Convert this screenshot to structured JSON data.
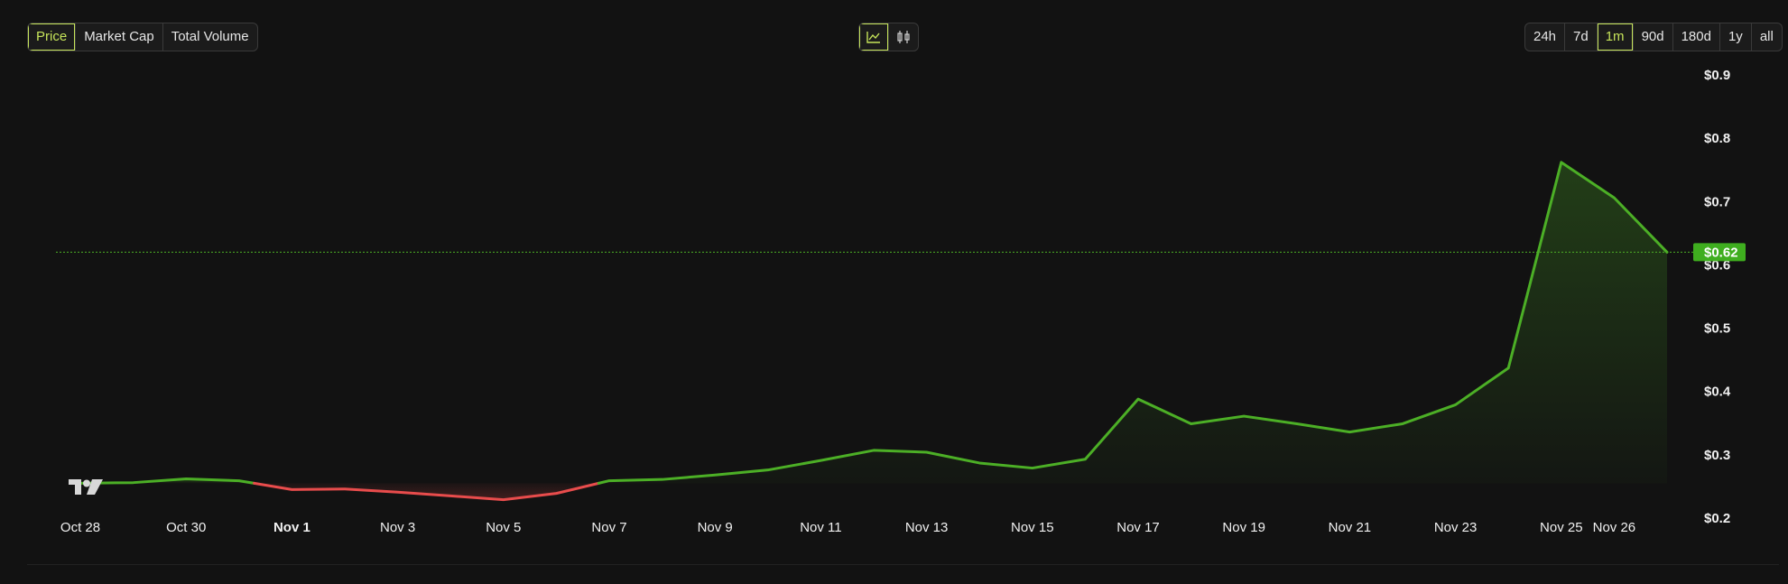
{
  "metric_tabs": [
    {
      "label": "Price",
      "active": true
    },
    {
      "label": "Market Cap",
      "active": false
    },
    {
      "label": "Total Volume",
      "active": false
    }
  ],
  "view_toggle": [
    {
      "icon": "line-chart-icon",
      "active": true
    },
    {
      "icon": "candlestick-icon",
      "active": false
    }
  ],
  "range_tabs": [
    {
      "label": "24h",
      "active": false
    },
    {
      "label": "7d",
      "active": false
    },
    {
      "label": "1m",
      "active": true
    },
    {
      "label": "90d",
      "active": false
    },
    {
      "label": "180d",
      "active": false
    },
    {
      "label": "1y",
      "active": false
    },
    {
      "label": "all",
      "active": false
    }
  ],
  "logo": "tradingview-logo-icon",
  "colors": {
    "up": "#4caf26",
    "down": "#e84c4c",
    "accent": "#c6e45a",
    "price_tag": "#3fae1f"
  },
  "chart_data": {
    "type": "line",
    "x": [
      "Oct 28",
      "Oct 29",
      "Oct 30",
      "Oct 31",
      "Nov 1",
      "Nov 2",
      "Nov 3",
      "Nov 4",
      "Nov 5",
      "Nov 6",
      "Nov 7",
      "Nov 8",
      "Nov 9",
      "Nov 10",
      "Nov 11",
      "Nov 12",
      "Nov 13",
      "Nov 14",
      "Nov 15",
      "Nov 16",
      "Nov 17",
      "Nov 18",
      "Nov 19",
      "Nov 20",
      "Nov 21",
      "Nov 22",
      "Nov 23",
      "Nov 24",
      "Nov 25",
      "Nov 26",
      "Nov 27"
    ],
    "x_tick_labels": [
      "Oct 28",
      "Oct 30",
      "Nov 1",
      "Nov 3",
      "Nov 5",
      "Nov 7",
      "Nov 9",
      "Nov 11",
      "Nov 13",
      "Nov 15",
      "Nov 17",
      "Nov 19",
      "Nov 21",
      "Nov 23",
      "Nov 25",
      "Nov 26"
    ],
    "bold_ticks": [
      "Nov 1"
    ],
    "series": [
      {
        "values": [
          0.255,
          0.256,
          0.262,
          0.259,
          0.245,
          0.246,
          0.241,
          0.235,
          0.229,
          0.239,
          0.259,
          0.261,
          0.268,
          0.276,
          0.291,
          0.307,
          0.304,
          0.287,
          0.279,
          0.293,
          0.388,
          0.349,
          0.361,
          0.349,
          0.336,
          0.349,
          0.379,
          0.437,
          0.762,
          0.706,
          0.62
        ]
      }
    ],
    "baseline": 0.255,
    "y_ticks": [
      "$0.2",
      "$0.3",
      "$0.4",
      "$0.5",
      "$0.6",
      "$0.7",
      "$0.8",
      "$0.9"
    ],
    "ylim": [
      0.17,
      0.95
    ],
    "current_price_label": "$0.62",
    "current_price": 0.62,
    "grid": false
  }
}
